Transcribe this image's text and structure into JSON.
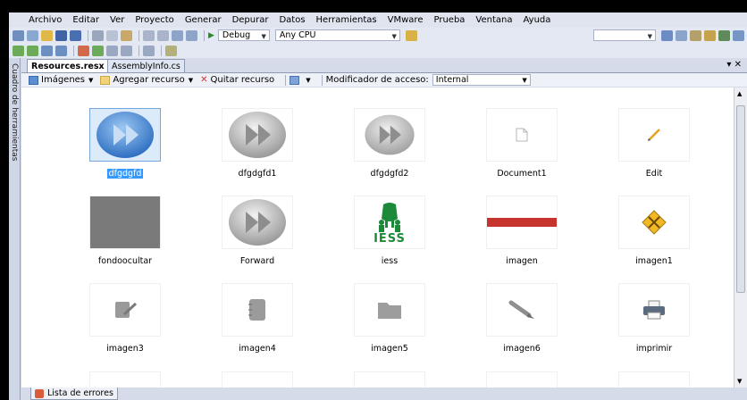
{
  "menu": [
    "Archivo",
    "Editar",
    "Ver",
    "Proyecto",
    "Generar",
    "Depurar",
    "Datos",
    "Herramientas",
    "VMware",
    "Prueba",
    "Ventana",
    "Ayuda"
  ],
  "toolbar": {
    "config": "Debug",
    "platform": "Any CPU"
  },
  "sidebar": {
    "label": "Cuadro de herramientas"
  },
  "tabs": [
    {
      "label": "Resources.resx",
      "active": true
    },
    {
      "label": "AssemblyInfo.cs",
      "active": false
    }
  ],
  "resource_toolbar": {
    "images": "Imágenes",
    "add": "Agregar recurso",
    "remove": "Quitar recurso",
    "access_label": "Modificador de acceso:",
    "access_value": "Internal"
  },
  "resources": [
    {
      "name": "dfgdgfd",
      "icon": "forward-blue-icon",
      "selected": true
    },
    {
      "name": "dfgdgfd1",
      "icon": "forward-gray-icon",
      "selected": false
    },
    {
      "name": "dfgdgfd2",
      "icon": "forward-gray-icon",
      "selected": false
    },
    {
      "name": "Document1",
      "icon": "document-icon",
      "selected": false
    },
    {
      "name": "Edit",
      "icon": "pencil-icon",
      "selected": false
    },
    {
      "name": "fondoocultar",
      "icon": "gray-square-image",
      "selected": false
    },
    {
      "name": "Forward",
      "icon": "forward-gray-icon",
      "selected": false
    },
    {
      "name": "iess",
      "icon": "iess-logo-image",
      "selected": false
    },
    {
      "name": "imagen",
      "icon": "red-banner-image",
      "selected": false
    },
    {
      "name": "imagen1",
      "icon": "warning-diamond-icon",
      "selected": false
    },
    {
      "name": "imagen3",
      "icon": "edit-doc-icon",
      "selected": false
    },
    {
      "name": "imagen4",
      "icon": "notepad-icon",
      "selected": false
    },
    {
      "name": "imagen5",
      "icon": "folder-icon",
      "selected": false
    },
    {
      "name": "imagen6",
      "icon": "brush-icon",
      "selected": false
    },
    {
      "name": "imprimir",
      "icon": "printer-icon",
      "selected": false
    }
  ],
  "iess_text": "IESS",
  "status": {
    "errors_tab": "Lista de errores"
  }
}
